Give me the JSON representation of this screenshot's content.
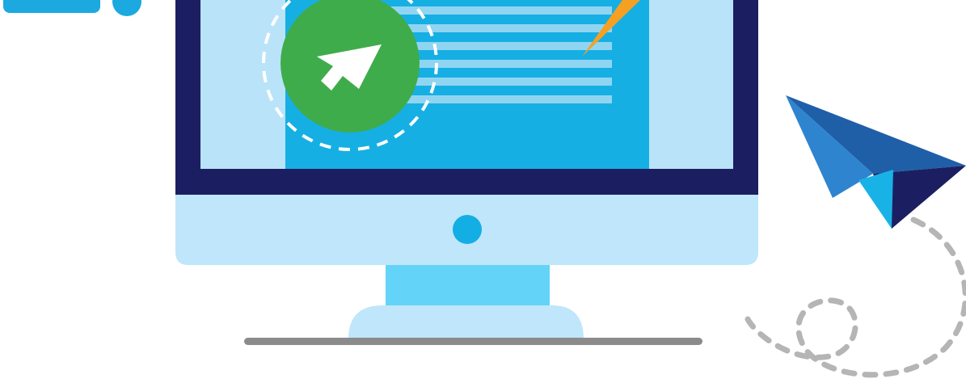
{
  "scene": {
    "description_colors": {
      "monitor_bezel": "#1b1f61",
      "screen_bg": "#b9e3f8",
      "screen_panel": "#16afe3",
      "panel_lines": "#8fd5f2",
      "chin": "#bfe6fa",
      "chin_dot": "#13aee4",
      "stand_neck": "#63d4f7",
      "stand_base": "#bfe6fa",
      "floor_line": "#8b8b8b",
      "green_button": "#3fac4b",
      "cursor_arrow": "#ffffff",
      "orange_accent": "#f5a023",
      "plane_dark": "#1f5fa8",
      "plane_mid": "#2e84cf",
      "plane_light": "#19b2e6",
      "plane_navy": "#1b1f61",
      "dashed_trail": "#b5b5b5",
      "top_left_bar": "#1ba9e0"
    },
    "icons": [
      "cursor-arrow-icon",
      "paper-plane-icon"
    ]
  }
}
